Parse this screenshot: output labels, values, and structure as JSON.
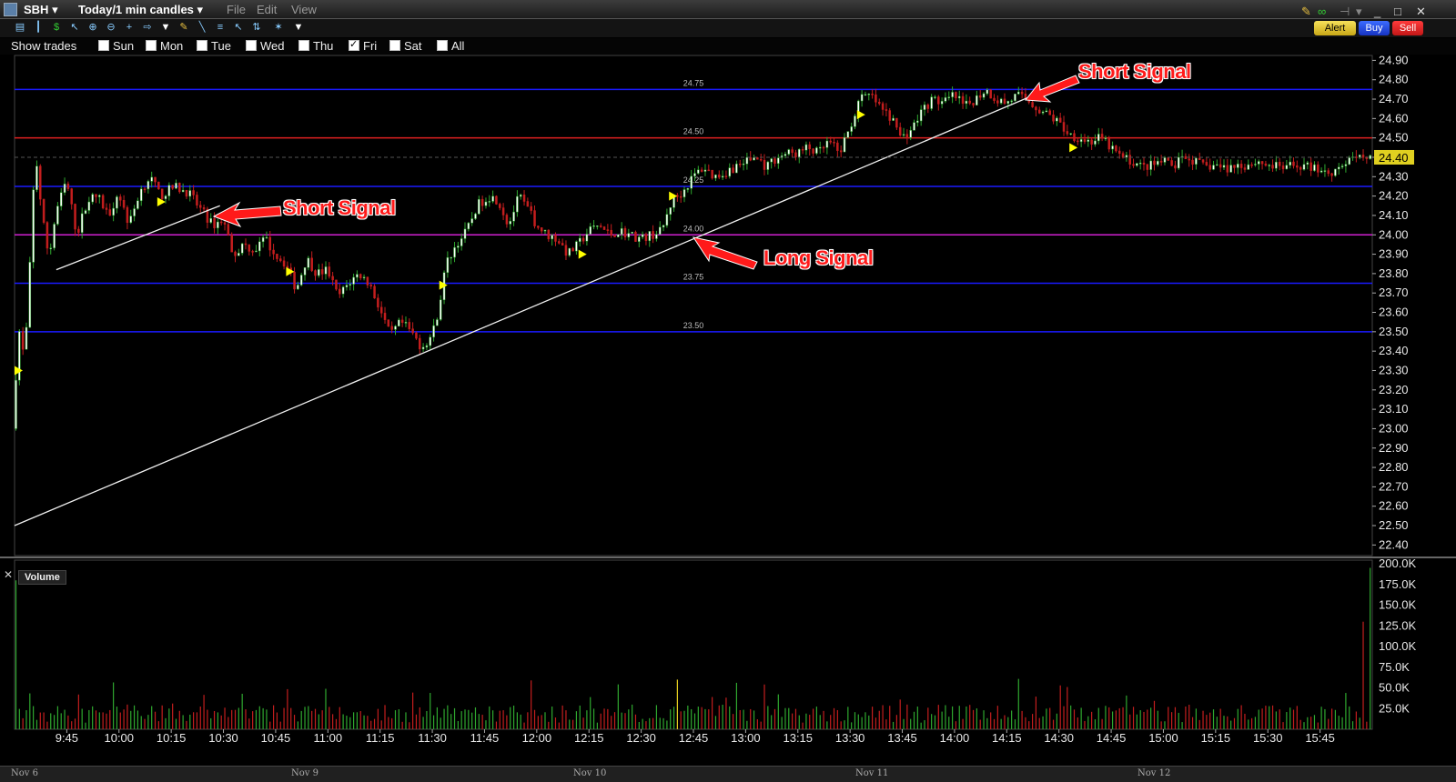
{
  "window": {
    "symbol": "SBH",
    "period": "Today/1 min candles",
    "menu": [
      "File",
      "Edit",
      "View"
    ]
  },
  "order_buttons": {
    "alert": "Alert",
    "buy": "Buy",
    "sell": "Sell"
  },
  "toolbar_icons": [
    "bar-chart-icon",
    "candlestick-icon",
    "dollar-icon",
    "cursor-icon",
    "zoom-in-icon",
    "zoom-out-icon",
    "crosshair-icon",
    "arrow-icon",
    "dropdown-icon",
    "pencil-icon",
    "trendline-icon",
    "fibonacci-icon",
    "pointer-icon",
    "trend-icon",
    "wrench-icon",
    "dropdown-icon"
  ],
  "show_trades": {
    "label": "Show trades",
    "days": [
      {
        "label": "Sun",
        "checked": false
      },
      {
        "label": "Mon",
        "checked": false
      },
      {
        "label": "Tue",
        "checked": false
      },
      {
        "label": "Wed",
        "checked": false
      },
      {
        "label": "Thu",
        "checked": false
      },
      {
        "label": "Fri",
        "checked": true
      },
      {
        "label": "Sat",
        "checked": false
      },
      {
        "label": "All",
        "checked": false
      }
    ]
  },
  "annotations": {
    "short_signal_1": "Short Signal",
    "short_signal_2": "Short Signal",
    "long_signal": "Long Signal"
  },
  "volume_panel": {
    "label": "Volume"
  },
  "colors": {
    "up": "#2fa82f",
    "down": "#c41e1e",
    "level_blue": "#1a1aff",
    "level_red": "#e02020",
    "level_magenta": "#d020d0",
    "marker": "#ffff00",
    "annotation": "#ff1a1a",
    "price_tag": "#e0d020"
  },
  "chart_data": {
    "type": "candlestick",
    "price_axis": {
      "ticks": [
        "24.90",
        "24.80",
        "24.70",
        "24.60",
        "24.50",
        "24.40",
        "24.30",
        "24.20",
        "24.10",
        "24.00",
        "23.90",
        "23.80",
        "23.70",
        "23.60",
        "23.50",
        "23.40",
        "23.30",
        "23.20",
        "23.10",
        "23.00",
        "22.90",
        "22.80",
        "22.70",
        "22.60",
        "22.50",
        "22.40"
      ],
      "range": [
        22.35,
        24.93
      ],
      "last_price": "24.40"
    },
    "volume_axis": {
      "ticks": [
        "200.0K",
        "175.0K",
        "150.0K",
        "125.0K",
        "100.0K",
        "75.0K",
        "50.0K",
        "25.0K"
      ],
      "range": [
        0,
        200000
      ]
    },
    "time_axis": {
      "start_minute": 570,
      "end_minute": 960,
      "ticks": [
        "9:45",
        "10:00",
        "10:15",
        "10:30",
        "10:45",
        "11:00",
        "11:15",
        "11:30",
        "11:45",
        "12:00",
        "12:15",
        "12:30",
        "12:45",
        "13:00",
        "13:15",
        "13:30",
        "13:45",
        "14:00",
        "14:15",
        "14:30",
        "14:45",
        "15:00",
        "15:15",
        "15:30",
        "15:45"
      ],
      "dates": [
        "Nov 6",
        "Nov 9",
        "Nov 10",
        "Nov 11",
        "Nov 12"
      ]
    },
    "levels": [
      {
        "price": 24.75,
        "label": "24.75",
        "color": "blue"
      },
      {
        "price": 24.5,
        "label": "24.50",
        "color": "red"
      },
      {
        "price": 24.25,
        "label": "24.25",
        "color": "blue"
      },
      {
        "price": 24.0,
        "label": "24.00",
        "color": "magenta"
      },
      {
        "price": 23.75,
        "label": "23.75",
        "color": "blue"
      },
      {
        "price": 23.5,
        "label": "23.50",
        "color": "blue"
      }
    ],
    "trendlines": [
      {
        "from": {
          "time": 570,
          "price": 22.5
        },
        "to": {
          "time": 864,
          "price": 24.73
        }
      },
      {
        "from": {
          "time": 582,
          "price": 23.82
        },
        "to": {
          "time": 629,
          "price": 24.15
        }
      }
    ],
    "price_path": [
      [
        570,
        23.0
      ],
      [
        571,
        23.55
      ],
      [
        573,
        23.35
      ],
      [
        575,
        24.0
      ],
      [
        576,
        24.45
      ],
      [
        578,
        24.1
      ],
      [
        580,
        23.88
      ],
      [
        582,
        24.12
      ],
      [
        585,
        24.28
      ],
      [
        588,
        24.0
      ],
      [
        591,
        24.18
      ],
      [
        594,
        24.2
      ],
      [
        597,
        24.1
      ],
      [
        600,
        24.22
      ],
      [
        603,
        24.05
      ],
      [
        606,
        24.22
      ],
      [
        609,
        24.3
      ],
      [
        612,
        24.2
      ],
      [
        616,
        24.25
      ],
      [
        620,
        24.22
      ],
      [
        624,
        24.12
      ],
      [
        627,
        24.05
      ],
      [
        630,
        24.08
      ],
      [
        633,
        23.9
      ],
      [
        636,
        23.95
      ],
      [
        639,
        23.92
      ],
      [
        642,
        23.98
      ],
      [
        645,
        23.9
      ],
      [
        648,
        23.85
      ],
      [
        651,
        23.72
      ],
      [
        654,
        23.88
      ],
      [
        657,
        23.8
      ],
      [
        660,
        23.82
      ],
      [
        663,
        23.68
      ],
      [
        666,
        23.75
      ],
      [
        669,
        23.8
      ],
      [
        672,
        23.75
      ],
      [
        675,
        23.62
      ],
      [
        678,
        23.48
      ],
      [
        681,
        23.55
      ],
      [
        684,
        23.5
      ],
      [
        687,
        23.42
      ],
      [
        690,
        23.48
      ],
      [
        692,
        23.62
      ],
      [
        694,
        23.85
      ],
      [
        697,
        23.95
      ],
      [
        700,
        24.02
      ],
      [
        703,
        24.15
      ],
      [
        706,
        24.2
      ],
      [
        709,
        24.18
      ],
      [
        712,
        24.05
      ],
      [
        715,
        24.2
      ],
      [
        718,
        24.12
      ],
      [
        720,
        24.05
      ],
      [
        723,
        24.0
      ],
      [
        726,
        23.98
      ],
      [
        729,
        23.9
      ],
      [
        732,
        23.95
      ],
      [
        735,
        24.02
      ],
      [
        738,
        24.05
      ],
      [
        741,
        24.0
      ],
      [
        744,
        24.02
      ],
      [
        747,
        24.0
      ],
      [
        750,
        23.98
      ],
      [
        753,
        24.0
      ],
      [
        756,
        24.02
      ],
      [
        759,
        24.18
      ],
      [
        762,
        24.22
      ],
      [
        765,
        24.3
      ],
      [
        768,
        24.35
      ],
      [
        771,
        24.3
      ],
      [
        774,
        24.32
      ],
      [
        777,
        24.35
      ],
      [
        780,
        24.38
      ],
      [
        783,
        24.4
      ],
      [
        786,
        24.35
      ],
      [
        789,
        24.4
      ],
      [
        792,
        24.42
      ],
      [
        795,
        24.42
      ],
      [
        798,
        24.45
      ],
      [
        801,
        24.42
      ],
      [
        804,
        24.48
      ],
      [
        807,
        24.42
      ],
      [
        810,
        24.55
      ],
      [
        813,
        24.7
      ],
      [
        816,
        24.72
      ],
      [
        819,
        24.65
      ],
      [
        822,
        24.6
      ],
      [
        825,
        24.5
      ],
      [
        828,
        24.55
      ],
      [
        831,
        24.65
      ],
      [
        834,
        24.7
      ],
      [
        837,
        24.68
      ],
      [
        840,
        24.72
      ],
      [
        843,
        24.66
      ],
      [
        846,
        24.7
      ],
      [
        849,
        24.75
      ],
      [
        852,
        24.7
      ],
      [
        855,
        24.68
      ],
      [
        858,
        24.72
      ],
      [
        861,
        24.7
      ],
      [
        864,
        24.65
      ],
      [
        867,
        24.62
      ],
      [
        870,
        24.58
      ],
      [
        873,
        24.52
      ],
      [
        876,
        24.5
      ],
      [
        879,
        24.48
      ],
      [
        882,
        24.5
      ],
      [
        885,
        24.45
      ],
      [
        888,
        24.4
      ],
      [
        891,
        24.38
      ],
      [
        894,
        24.35
      ],
      [
        897,
        24.36
      ],
      [
        900,
        24.38
      ],
      [
        903,
        24.35
      ],
      [
        906,
        24.4
      ],
      [
        909,
        24.38
      ],
      [
        912,
        24.35
      ],
      [
        915,
        24.36
      ],
      [
        918,
        24.34
      ],
      [
        921,
        24.36
      ],
      [
        924,
        24.36
      ],
      [
        927,
        24.38
      ],
      [
        930,
        24.36
      ],
      [
        933,
        24.35
      ],
      [
        936,
        24.35
      ],
      [
        939,
        24.36
      ],
      [
        942,
        24.35
      ],
      [
        945,
        24.34
      ],
      [
        948,
        24.32
      ],
      [
        951,
        24.36
      ],
      [
        954,
        24.38
      ],
      [
        957,
        24.4
      ],
      [
        960,
        24.42
      ]
    ],
    "markers": [
      {
        "time": 570,
        "price": 23.3
      },
      {
        "time": 611,
        "price": 24.17
      },
      {
        "time": 648,
        "price": 23.81
      },
      {
        "time": 692,
        "price": 23.74
      },
      {
        "time": 732,
        "price": 23.9
      },
      {
        "time": 758,
        "price": 24.2
      },
      {
        "time": 812,
        "price": 24.62
      },
      {
        "time": 873,
        "price": 24.45
      }
    ],
    "volume_spikes": [
      {
        "time": 570,
        "volume": 180000
      },
      {
        "time": 760,
        "volume": 60000
      },
      {
        "time": 957,
        "volume": 130000
      },
      {
        "time": 960,
        "volume": 195000
      }
    ]
  }
}
